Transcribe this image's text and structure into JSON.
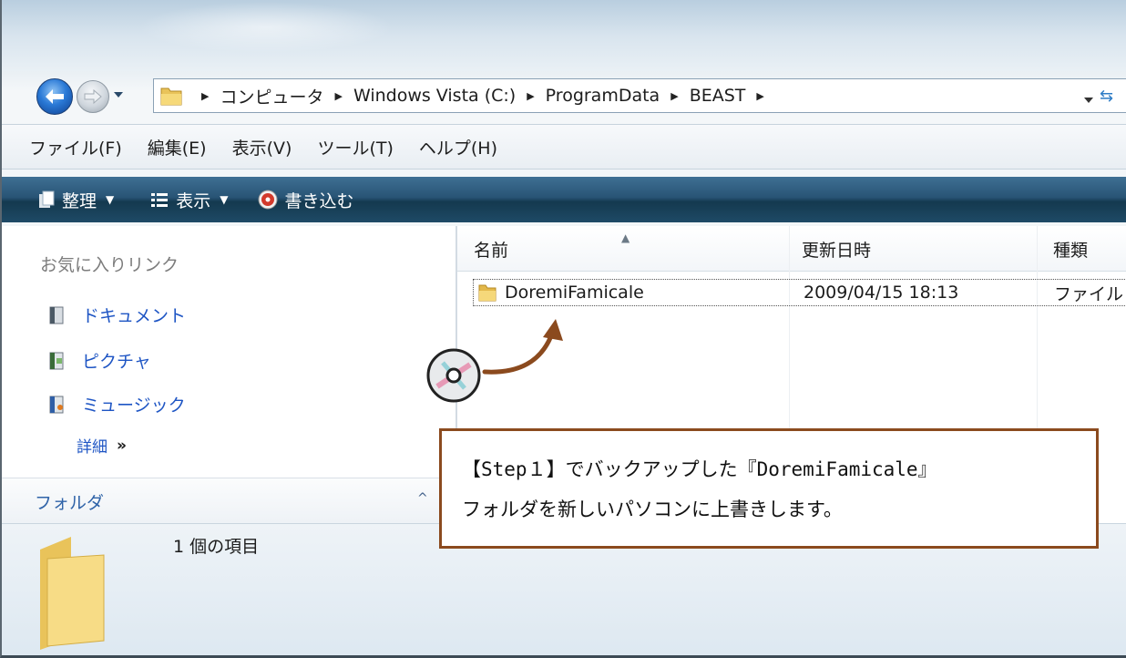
{
  "address_bar": {
    "crumbs": [
      "コンピュータ",
      "Windows Vista (C:)",
      "ProgramData",
      "BEAST"
    ]
  },
  "menu": {
    "items": [
      "ファイル(F)",
      "編集(E)",
      "表示(V)",
      "ツール(T)",
      "ヘルプ(H)"
    ]
  },
  "toolbar": {
    "organize": "整理",
    "views": "表示",
    "burn": "書き込む"
  },
  "sidebar": {
    "favorites_title": "お気に入りリンク",
    "items": [
      {
        "label": "ドキュメント",
        "icon": "documents-icon"
      },
      {
        "label": "ピクチャ",
        "icon": "pictures-icon"
      },
      {
        "label": "ミュージック",
        "icon": "music-icon"
      }
    ],
    "more_label": "詳細",
    "more_chevron": "»",
    "folders_label": "フォルダ",
    "folders_chevron": "^"
  },
  "file_list": {
    "columns": [
      "名前",
      "更新日時",
      "種類"
    ],
    "rows": [
      {
        "name": "DoremiFamicale",
        "modified": "2009/04/15 18:13",
        "type": "ファイル"
      }
    ]
  },
  "status": {
    "item_count": "1 個の項目"
  },
  "annotation": {
    "line1": "【Step１】でバックアップした『DoremiFamicale』",
    "line2": "フォルダを新しいパソコンに上書きします。",
    "border_color": "#8b4a1e"
  }
}
